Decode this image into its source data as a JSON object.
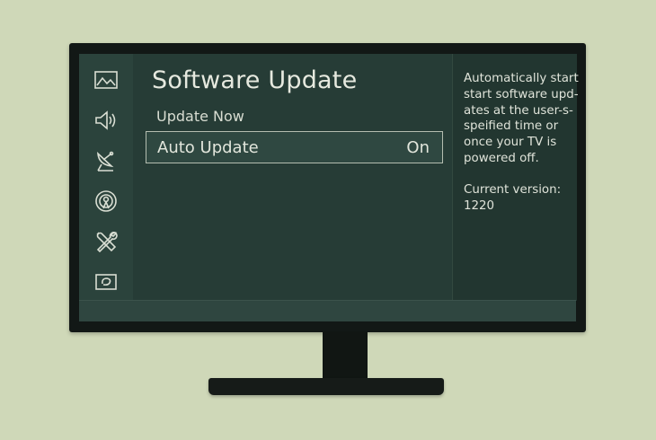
{
  "colors": {
    "background": "#cfd8b8",
    "screen": "#263c36",
    "text": "#e2e6dc",
    "bezel": "#121816"
  },
  "sidebar": {
    "icons": [
      "picture-icon",
      "sound-icon",
      "broadcast-icon",
      "network-icon",
      "tools-icon",
      "support-icon"
    ]
  },
  "main": {
    "title": "Software Update",
    "items": [
      {
        "label": "Update Now",
        "value": ""
      },
      {
        "label": "Auto Update",
        "value": "On"
      }
    ],
    "selected_item": "Auto Update"
  },
  "info": {
    "description_lines": [
      "Automatically start",
      "start software upd-",
      "ates at the user-s-",
      "speified time or",
      "once your TV is",
      "powered off."
    ],
    "version_label": "Current version:",
    "version_value": "1220"
  }
}
